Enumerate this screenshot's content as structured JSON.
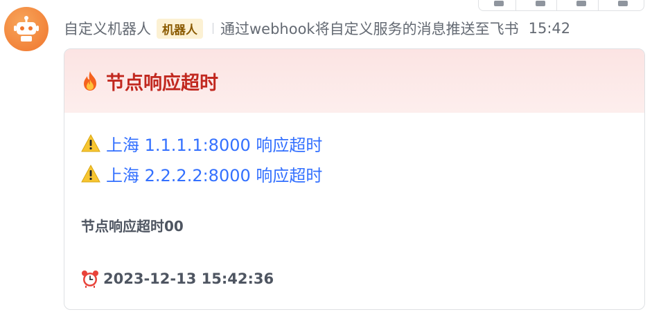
{
  "header": {
    "sender": "自定义机器人",
    "badge": "机器人",
    "description": "通过webhook将自定义服务的消息推送至飞书",
    "time": "15:42"
  },
  "card": {
    "title_icon": "fire-icon",
    "title": "节点响应超时",
    "header_color": "#fce4e3",
    "title_color": "#c1281f",
    "link_color": "#3370ff",
    "alerts": [
      {
        "icon": "warning-icon",
        "text": "上海 1.1.1.1:8000 响应超时"
      },
      {
        "icon": "warning-icon",
        "text": "上海 2.2.2.2:8000 响应超时"
      }
    ],
    "note": "节点响应超时00",
    "timestamp_icon": "alarm-clock-icon",
    "timestamp": "2023-12-13 15:42:36"
  }
}
